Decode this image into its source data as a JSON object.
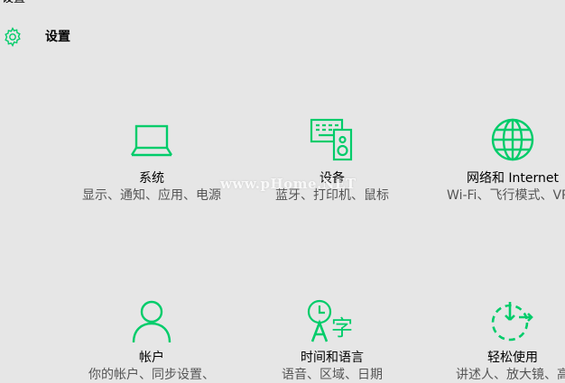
{
  "window": {
    "title": "设置"
  },
  "header": {
    "icon": "gear-icon",
    "title": "设置"
  },
  "accent_color": "#00cc6a",
  "tiles": [
    {
      "icon": "laptop-icon",
      "name": "系统",
      "desc": "显示、通知、应用、电源"
    },
    {
      "icon": "devices-icon",
      "name": "设备",
      "desc": "蓝牙、打印机、鼠标"
    },
    {
      "icon": "globe-icon",
      "name": "网络和 Internet",
      "desc": "Wi-Fi、飞行模式、VPN"
    },
    {
      "icon": "person-icon",
      "name": "帐户",
      "desc": "你的帐户、同步设置、"
    },
    {
      "icon": "time-language-icon",
      "name": "时间和语言",
      "desc": "语音、区域、日期"
    },
    {
      "icon": "ease-of-access-icon",
      "name": "轻松使用",
      "desc": "讲述人、放大镜、高"
    }
  ],
  "watermark": "www.pHome.NET"
}
